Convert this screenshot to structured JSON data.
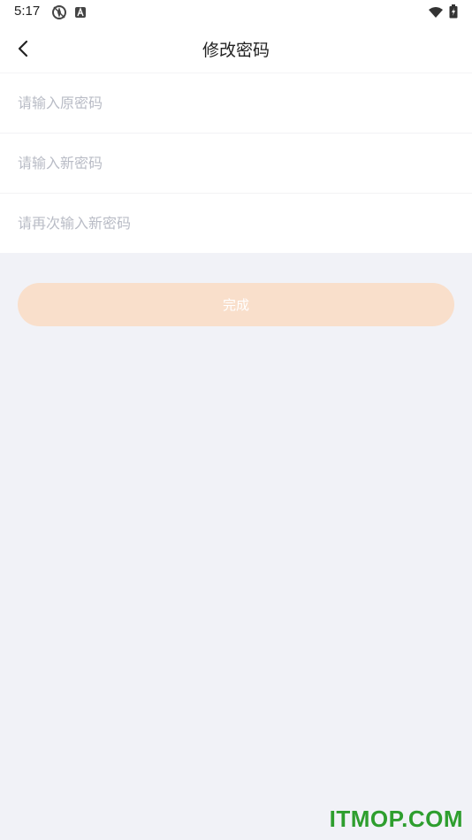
{
  "status_bar": {
    "time": "5:17",
    "icons": [
      "location-off-icon",
      "a-notification-icon",
      "wifi-icon",
      "battery-charging-icon"
    ]
  },
  "header": {
    "back_icon": "chevron-left-icon",
    "title": "修改密码"
  },
  "form": {
    "old_password_placeholder": "请输入原密码",
    "new_password_placeholder": "请输入新密码",
    "confirm_password_placeholder": "请再次输入新密码",
    "old_password_value": "",
    "new_password_value": "",
    "confirm_password_value": ""
  },
  "actions": {
    "submit_label": "完成"
  },
  "colors": {
    "accent_disabled": "#f9dfcb",
    "background": "#f1f2f7"
  },
  "watermark": "ITMOP.COM"
}
